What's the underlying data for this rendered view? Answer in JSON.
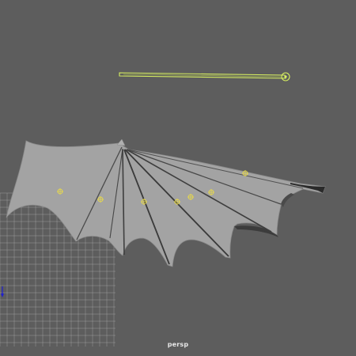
{
  "viewport": {
    "camera_label": "persp",
    "background_color": "#5d5d5d",
    "grid_color": "#c9c9c9",
    "mesh_color": "#a0a0a0",
    "selection_color": "#d8f060",
    "pivot_color": "#f0e040",
    "axis_color": "#2020d0"
  },
  "scene": {
    "objects": [
      {
        "name": "wing-mesh",
        "type": "polygon-mesh"
      },
      {
        "name": "control-curve",
        "type": "nurbs-curve",
        "selected": true
      }
    ],
    "pivot_icon": "crosshair-circle-icon",
    "pivot_count": 7
  }
}
